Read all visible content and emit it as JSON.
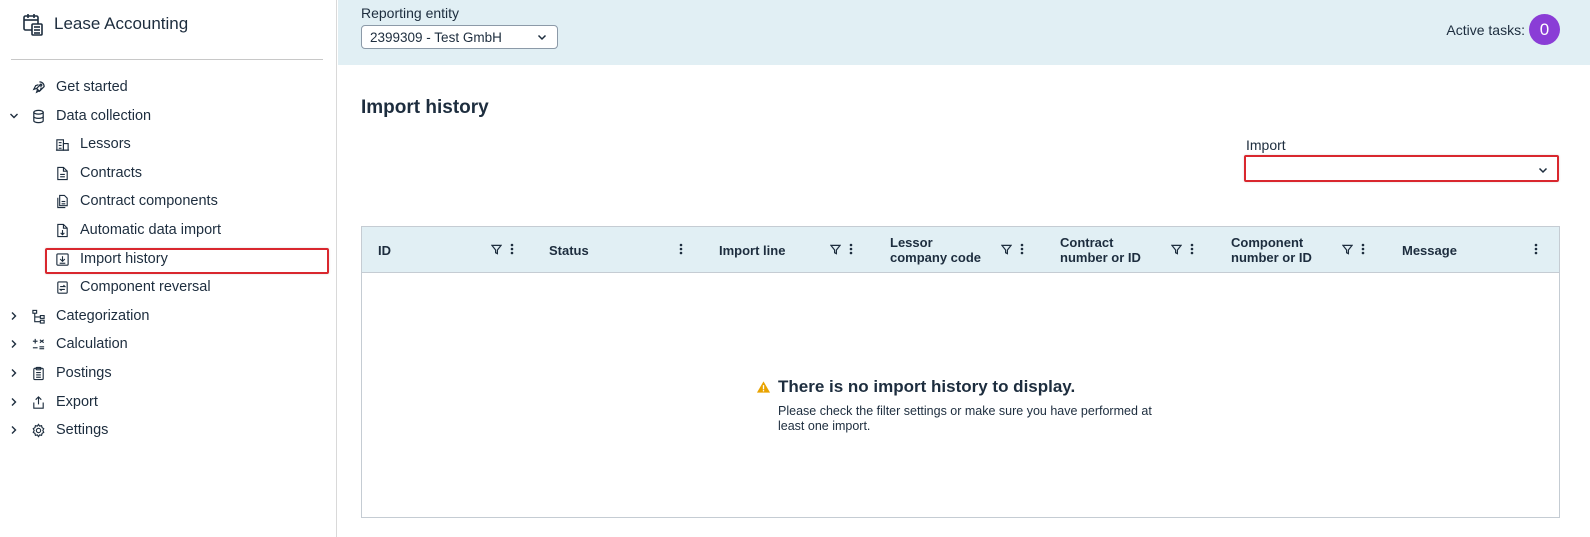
{
  "app": {
    "title": "Lease Accounting"
  },
  "sidebar": {
    "items": [
      {
        "label": "Get started",
        "icon": "rocket-icon"
      },
      {
        "label": "Data collection",
        "icon": "database-icon",
        "expanded": true
      },
      {
        "label": "Lessors",
        "icon": "building-icon"
      },
      {
        "label": "Contracts",
        "icon": "document-icon"
      },
      {
        "label": "Contract components",
        "icon": "documents-icon"
      },
      {
        "label": "Automatic data import",
        "icon": "document-import-icon"
      },
      {
        "label": "Import history",
        "icon": "download-history-icon",
        "selected": true
      },
      {
        "label": "Component reversal",
        "icon": "reversal-icon"
      },
      {
        "label": "Categorization",
        "icon": "hierarchy-icon"
      },
      {
        "label": "Calculation",
        "icon": "calculator-icon"
      },
      {
        "label": "Postings",
        "icon": "clipboard-icon"
      },
      {
        "label": "Export",
        "icon": "export-icon"
      },
      {
        "label": "Settings",
        "icon": "gear-icon"
      }
    ]
  },
  "topbar": {
    "entity_label": "Reporting entity",
    "entity_value": "2399309 - Test GmbH",
    "active_tasks_label": "Active tasks:",
    "active_tasks_count": "0"
  },
  "main": {
    "title": "Import history",
    "import_label": "Import",
    "import_value": ""
  },
  "table": {
    "columns": [
      {
        "label": "ID",
        "filter": true
      },
      {
        "label": "Status",
        "filter": false
      },
      {
        "label": "Import line",
        "filter": true
      },
      {
        "label": "Lessor company code",
        "filter": true
      },
      {
        "label": "Contract number or ID",
        "filter": true
      },
      {
        "label": "Component number or ID",
        "filter": true
      },
      {
        "label": "Message",
        "filter": false
      }
    ],
    "rows": [],
    "empty_title": "There is no import history to display.",
    "empty_message": "Please check the filter settings or make sure you have performed at least one import."
  },
  "colors": {
    "accent_purple": "#8a3dd6",
    "header_bg": "#e1eff4",
    "highlight_red": "#d9272e",
    "warning": "#e9a300"
  }
}
